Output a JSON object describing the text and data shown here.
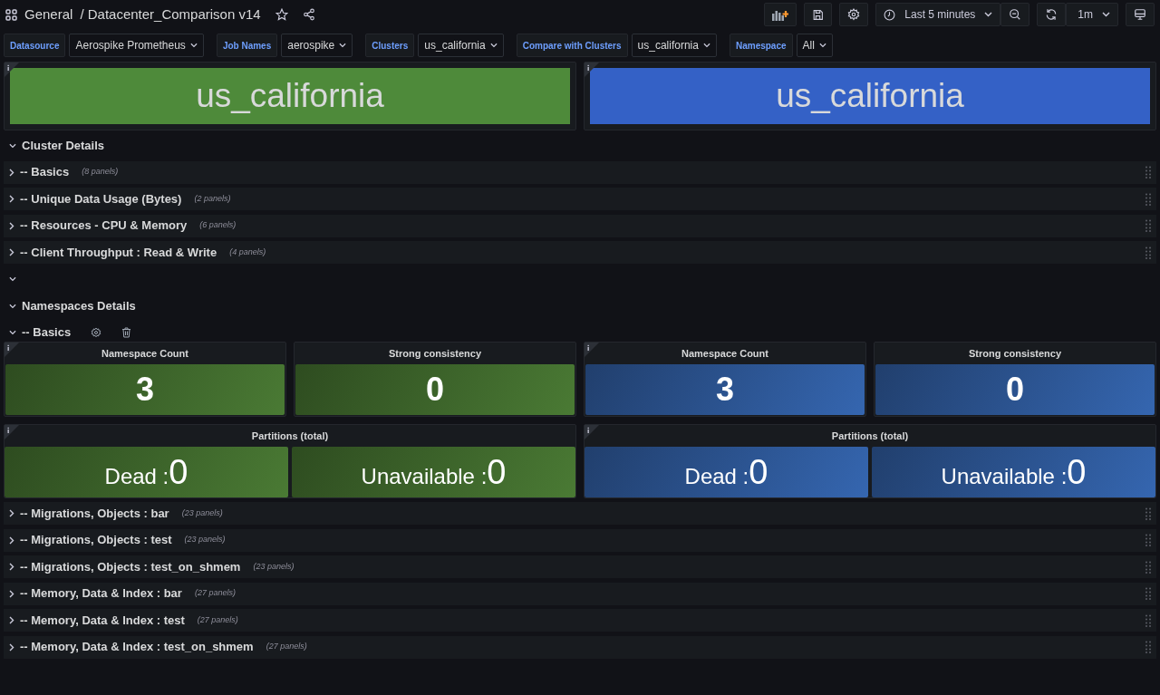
{
  "header": {
    "breadcrumb": "General",
    "title": "/ Datacenter_Comparison v14",
    "time_range": "Last 5 minutes",
    "refresh": "1m"
  },
  "variables": [
    {
      "label": "Datasource",
      "value": "Aerospike Prometheus"
    },
    {
      "label": "Job Names",
      "value": "aerospike"
    },
    {
      "label": "Clusters",
      "value": "us_california"
    },
    {
      "label": "Compare with Clusters",
      "value": "us_california"
    },
    {
      "label": "Namespace",
      "value": "All"
    }
  ],
  "banners": [
    {
      "text": "us_california",
      "color": "#4e8a3a"
    },
    {
      "text": "us_california",
      "color": "#3461c6"
    }
  ],
  "rows": [
    {
      "title": "Cluster Details",
      "expanded": true
    },
    {
      "title": "-- Basics",
      "panel_count": "(8 panels)",
      "expanded": false
    },
    {
      "title": "-- Unique Data Usage (Bytes)",
      "panel_count": "(2 panels)",
      "expanded": false
    },
    {
      "title": "-- Resources - CPU & Memory",
      "panel_count": "(6 panels)",
      "expanded": false
    },
    {
      "title": "-- Client Throughput : Read & Write",
      "panel_count": "(4 panels)",
      "expanded": false
    },
    {
      "expanded": true
    },
    {
      "title": "Namespaces Details",
      "expanded": true
    },
    {
      "title": "-- Basics",
      "expanded": true,
      "row_actions": true,
      "clusters": [
        {
          "color": "#4a7a34",
          "stats": [
            {
              "title": "Namespace Count",
              "value": "3"
            },
            {
              "title": "Strong consistency",
              "value": "0"
            }
          ],
          "partitions": {
            "title": "Partitions (total)",
            "items": [
              {
                "label": "Dead :",
                "value": "0"
              },
              {
                "label": "Unavailable :",
                "value": "0"
              }
            ]
          }
        },
        {
          "color": "#3566b0",
          "stats": [
            {
              "title": "Namespace Count",
              "value": "3"
            },
            {
              "title": "Strong consistency",
              "value": "0"
            }
          ],
          "partitions": {
            "title": "Partitions (total)",
            "items": [
              {
                "label": "Dead :",
                "value": "0"
              },
              {
                "label": "Unavailable :",
                "value": "0"
              }
            ]
          }
        }
      ]
    },
    {
      "title": "-- Migrations, Objects : bar",
      "panel_count": "(23 panels)",
      "expanded": false
    },
    {
      "title": "-- Migrations, Objects : test",
      "panel_count": "(23 panels)",
      "expanded": false
    },
    {
      "title": "-- Migrations, Objects : test_on_shmem",
      "panel_count": "(23 panels)",
      "expanded": false
    },
    {
      "title": "-- Memory, Data & Index : bar",
      "panel_count": "(27 panels)",
      "expanded": false
    },
    {
      "title": "-- Memory, Data & Index : test",
      "panel_count": "(27 panels)",
      "expanded": false
    },
    {
      "title": "-- Memory, Data & Index : test_on_shmem",
      "panel_count": "(27 panels)",
      "expanded": false
    }
  ]
}
